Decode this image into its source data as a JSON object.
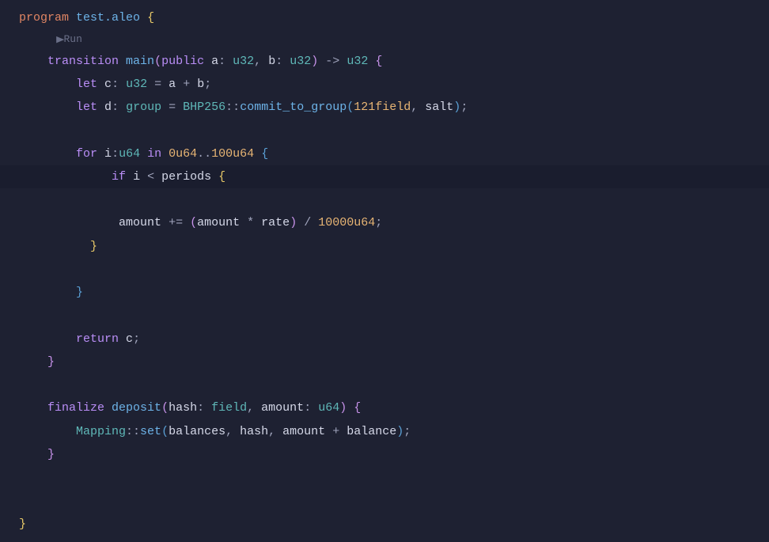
{
  "codelens": {
    "run": "Run"
  },
  "code": {
    "l1": {
      "program": "program",
      "name": "test.aleo",
      "brace": "{"
    },
    "l3": {
      "transition": "transition",
      "main": "main",
      "lparen": "(",
      "public": "public",
      "a": "a",
      "colon1": ":",
      "u32_1": "u32",
      "comma": ",",
      "b": "b",
      "colon2": ":",
      "u32_2": "u32",
      "rparen": ")",
      "arrow": "->",
      "u32_3": "u32",
      "brace": "{"
    },
    "l4": {
      "let": "let",
      "c": "c",
      "colon": ":",
      "u32": "u32",
      "eq": "=",
      "a": "a",
      "plus": "+",
      "b": "b",
      "semi": ";"
    },
    "l5": {
      "let": "let",
      "d": "d",
      "colon": ":",
      "group": "group",
      "eq": "=",
      "bhp": "BHP256",
      "dcolon": "::",
      "commit": "commit_to_group",
      "lparen": "(",
      "field": "121field",
      "comma": ",",
      "salt": "salt",
      "rparen": ")",
      "semi": ";"
    },
    "l7": {
      "for": "for",
      "i": "i",
      "colon": ":",
      "u64": "u64",
      "in": "in",
      "start": "0u64",
      "range": "..",
      "end": "100u64",
      "brace": "{"
    },
    "l8": {
      "if": "if",
      "i": "i",
      "lt": "<",
      "periods": "periods",
      "brace": "{"
    },
    "l10": {
      "amount1": "amount",
      "pluseq": "+=",
      "lparen": "(",
      "amount2": "amount",
      "mul": "*",
      "rate": "rate",
      "rparen": ")",
      "div": "/",
      "num": "10000u64",
      "semi": ";"
    },
    "l11": {
      "brace": "}"
    },
    "l13": {
      "brace": "}"
    },
    "l15": {
      "return": "return",
      "c": "c",
      "semi": ";"
    },
    "l16": {
      "brace": "}"
    },
    "l18": {
      "finalize": "finalize",
      "deposit": "deposit",
      "lparen": "(",
      "hash": "hash",
      "colon1": ":",
      "field": "field",
      "comma": ",",
      "amount": "amount",
      "colon2": ":",
      "u64": "u64",
      "rparen": ")",
      "brace": "{"
    },
    "l19": {
      "mapping": "Mapping",
      "dcolon": "::",
      "set": "set",
      "lparen": "(",
      "balances": "balances",
      "comma1": ",",
      "hash": "hash",
      "comma2": ",",
      "amount": "amount",
      "plus": "+",
      "balance": "balance",
      "rparen": ")",
      "semi": ";"
    },
    "l20": {
      "brace": "}"
    },
    "l23": {
      "brace": "}"
    }
  }
}
